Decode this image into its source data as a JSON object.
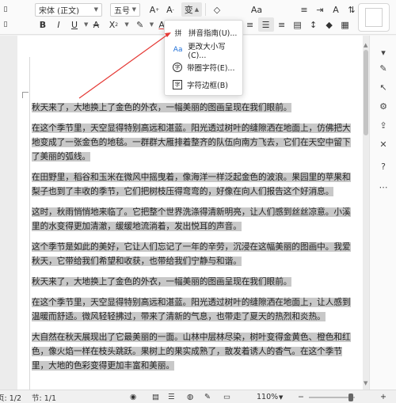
{
  "ribbon": {
    "font_name": "宋体 (正文)",
    "font_size": "五号",
    "row1_icons": [
      "increase-font-size-icon",
      "decrease-font-size-icon",
      "phonetic-guide-icon",
      "clear-format-icon"
    ],
    "row2_icons": [
      "bold-icon",
      "italic-icon",
      "underline-icon",
      "strikethrough-icon",
      "superscript-icon",
      "highlight-icon",
      "font-color-icon",
      "char-border-icon"
    ],
    "para_icons": [
      "bullets-icon",
      "numbering-icon",
      "indent-icon",
      "align-left-icon",
      "align-center-icon",
      "align-right-icon",
      "justify-icon",
      "distributed-icon",
      "line-spacing-icon",
      "shading-icon",
      "borders-icon"
    ]
  },
  "dropdown": {
    "items": [
      {
        "icon": "拼",
        "label": "拼音指南(U)..."
      },
      {
        "icon": "Aa",
        "label": "更改大小写(C)..."
      },
      {
        "icon": "字",
        "label": "带圈字符(E)..."
      },
      {
        "icon": "字",
        "label": "字符边框(B)"
      }
    ]
  },
  "document": {
    "paragraphs": [
      "秋天来了，大地换上了金色的外衣，一幅美丽的图画呈现在我们眼前。",
      "在这个季节里，天空显得特别高远和湛蓝。阳光透过树叶的缝隙洒在地面上，仿佛把大地变成了一张金色的地毯。一群群大雁排着整齐的队伍向南方飞去，它们在天空中留下了美丽的弧线。",
      "在田野里，稻谷和玉米在微风中摇曳着，像海洋一样泛起金色的波浪。果园里的苹果和梨子也到了丰收的季节，它们把树枝压得弯弯的，好像在向人们报告这个好消息。",
      "这时，秋雨悄悄地来临了。它把整个世界洗涤得清新明亮，让人们感到丝丝凉意。小溪里的水变得更加清澈，缓缓地流淌着，发出悦耳的声音。",
      "这个季节是如此的美好，它让人们忘记了一年的辛劳，沉浸在这幅美丽的图画中。我爱秋天，它带给我们希望和收获，也带给我们宁静与和谐。",
      "秋天来了，大地换上了金色的外衣，一幅美丽的图画呈现在我们眼前。",
      "在这个季节里，天空显得特别高远和湛蓝。阳光透过树叶的缝隙洒在地面上，让人感到温暖而舒适。微风轻轻拂过，带来了清新的气息，也带走了夏天的热烈和炎热。",
      "大自然在秋天展现出了它最美丽的一面。山林中层林尽染，树叶变得金黄色、橙色和红色，像火焰一样在枝头跳跃。果树上的果实成熟了，散发着诱人的香气。在这个季节里，大地的色彩变得更加丰富和美丽。"
    ]
  },
  "status": {
    "page": "页: 1/2",
    "section": "节: 1/1",
    "zoom": "110%"
  },
  "colors": {
    "selection": "#c8c8c8",
    "annotation_arrow": "#e53935"
  }
}
